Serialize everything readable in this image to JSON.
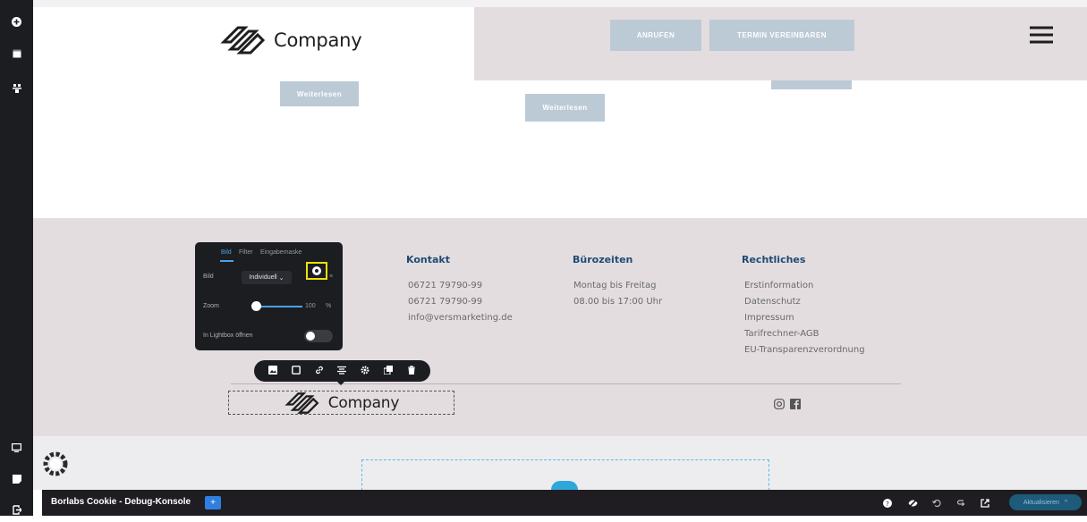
{
  "header": {
    "logo_text": "Company",
    "btn_call": "ANRUFEN",
    "btn_appointment": "TERMIN VEREINBAREN",
    "menu_icon": "hamburger-icon"
  },
  "content": {
    "read_more_1": "Weiterlesen",
    "read_more_2": "Weiterlesen"
  },
  "footer": {
    "kontakt": {
      "heading": "Kontakt",
      "lines": [
        "06721 79790-99",
        "06721 79790-99",
        "info@versmarketing.de"
      ]
    },
    "hours": {
      "heading": "Bürozeiten",
      "lines": [
        "Montag bis Freitag",
        "08.00 bis 17:00 Uhr"
      ]
    },
    "legal": {
      "heading": "Rechtliches",
      "lines": [
        "Erstinformation",
        "Datenschutz",
        "Impressum",
        "Tarifrechner-AGB",
        "EU-Transparenzverordnung"
      ]
    },
    "logo_text": "Company",
    "social_icons": [
      "instagram-icon",
      "facebook-icon"
    ]
  },
  "popup": {
    "tabs": [
      "Bild",
      "Filter",
      "Eingabemaske"
    ],
    "active_tab": "Bild",
    "image_label": "Bild",
    "image_mode": "Individuell",
    "zoom_label": "Zoom",
    "zoom_value": "100",
    "zoom_unit": "%",
    "lightbox_label": "In Lightbox öffnen"
  },
  "toolbar": {
    "icons": [
      "image-icon",
      "square-icon",
      "link-icon",
      "align-icon",
      "gear-icon",
      "duplicate-icon",
      "trash-icon"
    ]
  },
  "debug": {
    "title": "Borlabs Cookie - Debug-Konsole",
    "plus": "+",
    "update_label": "Aktualisieren"
  },
  "colors": {
    "sidebar": "#1b1d21",
    "footer_bg": "#e3dde0",
    "heading_blue": "#1f4b73",
    "button_grey": "#bccad6",
    "highlight": "#f4e000"
  }
}
